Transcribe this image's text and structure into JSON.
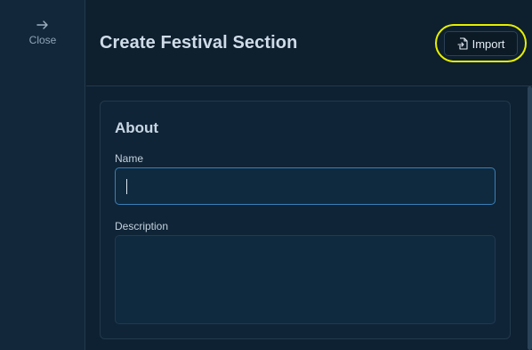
{
  "sidebar": {
    "close_label": "Close",
    "close_icon": "arrow-right-icon"
  },
  "header": {
    "title": "Create Festival Section",
    "import_label": "Import",
    "import_icon": "file-import-icon"
  },
  "form": {
    "section_title": "About",
    "name_label": "Name",
    "name_value": "",
    "description_label": "Description",
    "description_value": ""
  },
  "colors": {
    "highlight": "#e6f000",
    "focus_border": "#3a7fb8",
    "background": "#0f2132"
  }
}
